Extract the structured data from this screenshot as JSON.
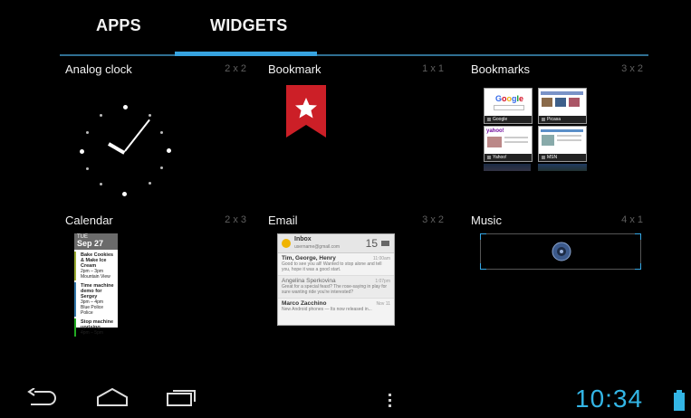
{
  "tabs": {
    "apps": "APPS",
    "widgets": "WIDGETS"
  },
  "widgets": [
    {
      "name": "Analog clock",
      "size": "2 x 2"
    },
    {
      "name": "Bookmark",
      "size": "1 x 1"
    },
    {
      "name": "Bookmarks",
      "size": "3 x 2"
    },
    {
      "name": "Calendar",
      "size": "2 x 3"
    },
    {
      "name": "Email",
      "size": "3 x 2"
    },
    {
      "name": "Music",
      "size": "4 x 1"
    }
  ],
  "bookmarks_preview": [
    "Google",
    "Picasa",
    "Yahoo!",
    "MSN"
  ],
  "calendar_preview": {
    "day": "Sep 27",
    "weekday": "TUE",
    "events": [
      {
        "title": "Bake Cookies & Make Ice Cream",
        "time": "2pm – 3pm",
        "place": "Mountain View"
      },
      {
        "title": "Time machine demo for Sergey",
        "time": "3pm – 4pm",
        "place": "Blue Police Police"
      },
      {
        "title": "Stop machine uprising",
        "time": "4pm – 5pm",
        "place": ""
      }
    ]
  },
  "email_preview": {
    "header_title": "Inbox",
    "header_account": "username@gmail.com",
    "count": "15",
    "messages": [
      {
        "from": "Tim, George, Henry",
        "snippet": "Good to see you all! Wanted to stop alone and tell you, hope it was a good start.",
        "time": "11:00am"
      },
      {
        "from": "Angelina Sperkovina",
        "snippet": "Great for a special feast? The rose-saying in play for sure wanting ride you're interested?",
        "time": "1:07pm"
      },
      {
        "from": "Marco Zacchino",
        "snippet": "New Android phones — Its now released in...",
        "time": "Nov 11"
      }
    ]
  },
  "status": {
    "time": "10:34"
  },
  "colors": {
    "accent": "#33b5e5",
    "tab_line": "#2f6f92",
    "bookmark_red": "#cc1f27"
  },
  "icons": [
    "back-icon",
    "home-icon",
    "recent-apps-icon",
    "menu-icon",
    "battery-icon",
    "speaker-icon",
    "star-icon"
  ]
}
